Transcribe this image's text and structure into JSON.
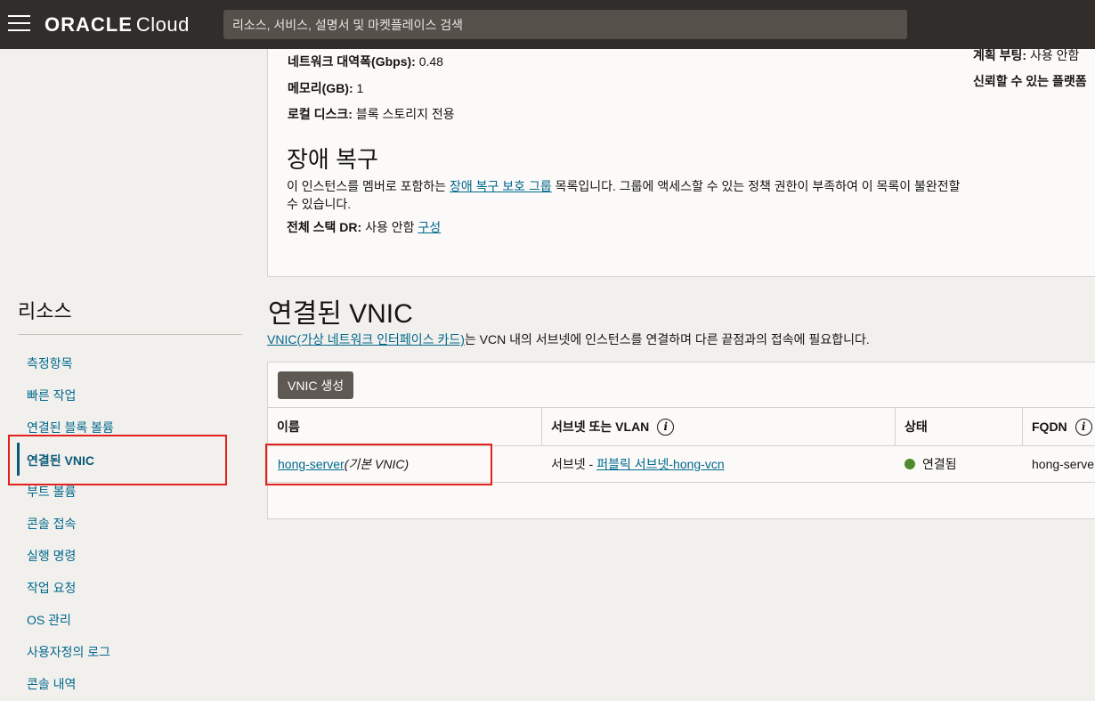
{
  "header": {
    "brand": "ORACLE",
    "product": "Cloud",
    "search_placeholder": "리소스, 서비스, 설명서 및 마켓플레이스 검색"
  },
  "details": {
    "bandwidth_label": "네트워크 대역폭(Gbps):",
    "bandwidth_value": " 0.48",
    "memory_label": "메모리(GB):",
    "memory_value": " 1",
    "local_disk_label": "로컬 디스크:",
    "local_disk_value": " 블록 스토리지 전용",
    "right_col": {
      "planned_maintenance_label": "계획 부팅:",
      "planned_maintenance_value": " 사용 안함",
      "shielded_label": "신뢰할 수 있는 플랫폼"
    },
    "disaster_recovery": {
      "title": "장애 복구",
      "desc_before": "이 인스턴스를 멤버로 포함하는 ",
      "desc_link": "장애 복구 보호 그룹",
      "desc_after": " 목록입니다. 그룹에 액세스할 수 있는 정책 권한이 부족하여 이 목록이 불완전할 수 있습니다.",
      "full_stack_label": "전체 스택 DR:",
      "full_stack_value": " 사용 안함 ",
      "configure_link": "구성"
    }
  },
  "sidebar": {
    "title": "리소스",
    "items": [
      {
        "label": "측정항목"
      },
      {
        "label": "빠른 작업"
      },
      {
        "label": "연결된 블록 볼륨"
      },
      {
        "label": "연결된 VNIC"
      },
      {
        "label": "부트 볼륨"
      },
      {
        "label": "콘솔 접속"
      },
      {
        "label": "실행 명령"
      },
      {
        "label": "작업 요청"
      },
      {
        "label": "OS 관리"
      },
      {
        "label": "사용자정의 로그"
      },
      {
        "label": "콘솔 내역"
      }
    ]
  },
  "vnic": {
    "title": "연결된 VNIC",
    "desc_link": "VNIC(가상 네트워크 인터페이스 카드)",
    "desc_after": "는 VCN 내의 서브넷에 인스턴스를 연결하며 다른 끝점과의 접속에 필요합니다.",
    "create_button": "VNIC 생성",
    "columns": [
      "이름",
      "서브넷 또는 VLAN",
      "상태",
      "FQDN"
    ],
    "rows": [
      {
        "name": "hong-server",
        "name_suffix": " (기본 VNIC)",
        "subnet_prefix": "서브넷 - ",
        "subnet_link": "퍼블릭 서브넷-hong-vcn",
        "status": "연결됨",
        "fqdn": "hong-serve..."
      }
    ]
  },
  "colors": {
    "topbar": "#312d2a",
    "link": "#00688c",
    "highlight": "#e2201c",
    "status_ok": "#4e8a2e"
  }
}
